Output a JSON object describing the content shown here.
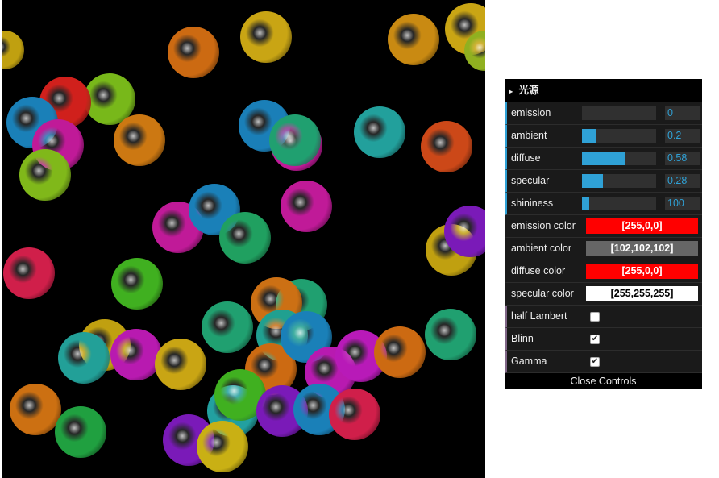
{
  "gui": {
    "folder_title": "光源",
    "folder_arrow": "▸",
    "sliders": [
      {
        "label": "emission",
        "value": "0",
        "fraction": 0
      },
      {
        "label": "ambient",
        "value": "0.2",
        "fraction": 0.2
      },
      {
        "label": "diffuse",
        "value": "0.58",
        "fraction": 0.58
      },
      {
        "label": "specular",
        "value": "0.28",
        "fraction": 0.28
      },
      {
        "label": "shininess",
        "value": "100",
        "fraction": 0.1
      }
    ],
    "colors": [
      {
        "label": "emission color",
        "value": "[255,0,0]",
        "hex": "#ff0000",
        "text_color": "#ffffff"
      },
      {
        "label": "ambient color",
        "value": "[102,102,102]",
        "hex": "#666666",
        "text_color": "#ffffff"
      },
      {
        "label": "diffuse color",
        "value": "[255,0,0]",
        "hex": "#ff0000",
        "text_color": "#ffffff"
      },
      {
        "label": "specular color",
        "value": "[255,255,255]",
        "hex": "#ffffff",
        "text_color": "#000000"
      }
    ],
    "toggles": [
      {
        "label": "half Lambert",
        "checked": false
      },
      {
        "label": "Blinn",
        "checked": true
      },
      {
        "label": "Gamma",
        "checked": true
      }
    ],
    "close_label": "Close Controls"
  },
  "scene": {
    "description_colors": [
      "#c0a010",
      "#cc6610",
      "#d01f3a",
      "#1a7fb8",
      "#20a070",
      "#22a0a0",
      "#b81ab8",
      "#7a1ab8",
      "#40b020",
      "#7cb820"
    ]
  }
}
